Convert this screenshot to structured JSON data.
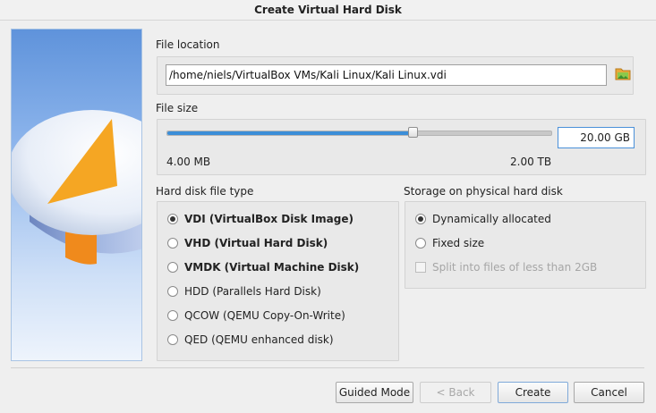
{
  "window": {
    "title": "Create Virtual Hard Disk"
  },
  "file_location": {
    "label": "File location",
    "path": "/home/niels/VirtualBox VMs/Kali Linux/Kali Linux.vdi",
    "browse_icon": "folder-icon"
  },
  "file_size": {
    "label": "File size",
    "value": "20.00 GB",
    "min_label": "4.00 MB",
    "max_label": "2.00 TB",
    "slider_fraction": 0.64
  },
  "disk_type": {
    "label": "Hard disk file type",
    "options": [
      {
        "label": "VDI (VirtualBox Disk Image)",
        "selected": true
      },
      {
        "label": "VHD (Virtual Hard Disk)",
        "selected": false
      },
      {
        "label": "VMDK (Virtual Machine Disk)",
        "selected": false
      },
      {
        "label": "HDD (Parallels Hard Disk)",
        "selected": false
      },
      {
        "label": "QCOW (QEMU Copy-On-Write)",
        "selected": false
      },
      {
        "label": "QED (QEMU enhanced disk)",
        "selected": false
      }
    ]
  },
  "storage": {
    "label": "Storage on physical hard disk",
    "options": [
      {
        "label": "Dynamically allocated",
        "selected": true
      },
      {
        "label": "Fixed size",
        "selected": false
      }
    ],
    "split_label": "Split into files of less than 2GB",
    "split_checked": false
  },
  "buttons": {
    "guided": "Guided Mode",
    "back": "< Back",
    "create": "Create",
    "cancel": "Cancel"
  },
  "colors": {
    "accent": "#3b8ed8",
    "disk_orange": "#f5a623"
  }
}
